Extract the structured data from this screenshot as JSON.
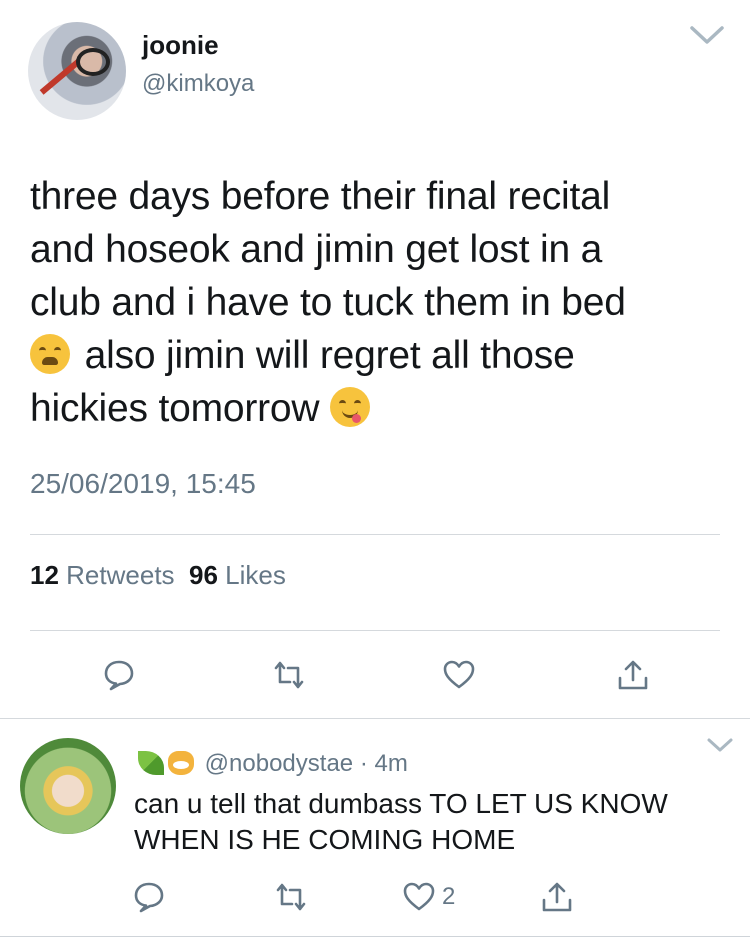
{
  "tweet": {
    "display_name": "joonie",
    "handle": "@kimkoya",
    "text_part1": "three days before their final recital\nand hoseok and jimin get lost in a\nclub and i have to tuck them in bed\n",
    "text_part2": " also jimin will regret all those\nhickies tomorrow ",
    "emojis": [
      "weary-face-emoji",
      "yum-face-emoji"
    ],
    "timestamp": "25/06/2019, 15:45",
    "retweet_count": "12",
    "retweet_label": "Retweets",
    "like_count": "96",
    "like_label": "Likes"
  },
  "reply": {
    "handle": "@nobodystae",
    "separator": "·",
    "time": "4m",
    "text": "can u tell that dumbass TO LET US KNOW WHEN IS HE COMING HOME",
    "like_count": "2"
  },
  "colors": {
    "text": "#14171a",
    "secondary": "#657786",
    "divider": "#d5d9dd"
  }
}
